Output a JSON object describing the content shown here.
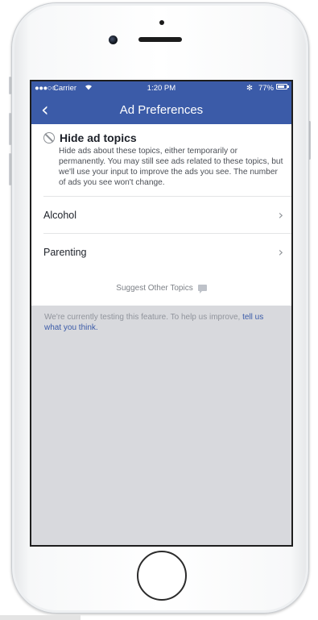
{
  "status_bar": {
    "signal": "●●●○○",
    "carrier": "Carrier",
    "wifi_icon": "wifi-icon",
    "time": "1:20 PM",
    "bluetooth": "✻",
    "battery_percent": "77%",
    "battery_level": 0.77
  },
  "nav": {
    "back_label": "‹",
    "title": "Ad Preferences"
  },
  "section": {
    "title": "Hide ad topics",
    "description": "Hide ads about these topics, either temporarily or permanently. You may still see ads related to these topics, but we'll use your input to improve the ads you see. The number of ads you see won't change."
  },
  "topics": [
    {
      "label": "Alcohol",
      "chevron": "›"
    },
    {
      "label": "Parenting",
      "chevron": "›"
    }
  ],
  "suggest": {
    "label": "Suggest Other Topics"
  },
  "footer": {
    "text": "We're currently testing this feature. To help us improve, ",
    "link": "tell us what you think."
  },
  "colors": {
    "accent": "#3b5ba8",
    "screen_background": "#d8d9dd"
  }
}
